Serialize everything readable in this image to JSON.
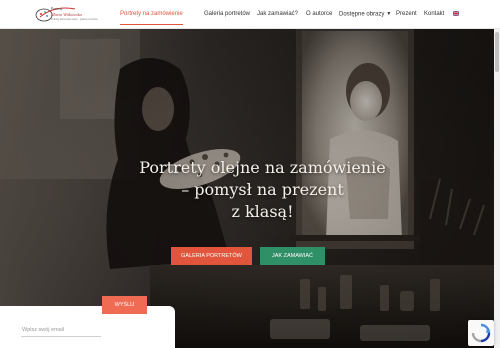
{
  "header": {
    "logo": {
      "line1": "Portrety",
      "line2": "Marta Witkowska",
      "line3": "Portrety malowane olejno · galeria portretów"
    },
    "nav": [
      {
        "label": "Portrety na zamówienie",
        "active": true
      },
      {
        "label": "Galeria portretów"
      },
      {
        "label": "Jak zamawiać?"
      },
      {
        "label": "O autorce"
      },
      {
        "label": "Dostępne obrazy",
        "dropdown": true
      },
      {
        "label": "Prezent"
      },
      {
        "label": "Kontakt"
      }
    ],
    "language_flag": "uk-flag-icon",
    "accent_color": "#e0533c"
  },
  "hero": {
    "headline": [
      "Portrety olejne na zamówienie",
      "– pomysł na prezent",
      "z klasą!"
    ],
    "buttons": {
      "gallery": "GALERIA PORTRETÓW",
      "how_to_order": "JAK ZAMAWIAĆ"
    },
    "colors": {
      "gallery_button": "#e0553c",
      "how_button": "#2f8f67"
    }
  },
  "newsletter": {
    "placeholder": "Wpisz swój email",
    "button": "WYŚLIJ"
  }
}
